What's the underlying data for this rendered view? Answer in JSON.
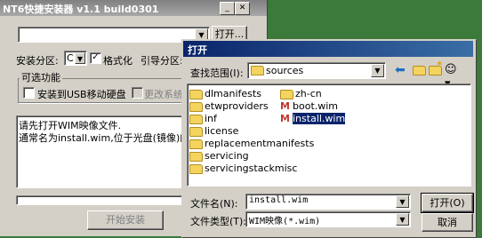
{
  "main_window": {
    "title": "NT6快捷安装器 v1.1 build0301",
    "open_button": "打开...",
    "install_partition_label": "安装分区:",
    "install_partition_value": "C",
    "format_label": "格式化",
    "boot_partition_label": "引导分区:",
    "options_group_label": "可选功能",
    "usb_install_label": "安装到USB移动硬盘",
    "change_system_label": "更改系统占",
    "log_lines": [
      "请先打开WIM映像文件.",
      "通常名为install.wim,位于光盘(镜像)的sources"
    ],
    "start_install_button": "开始安装"
  },
  "open_dialog": {
    "title": "打开",
    "look_in_label": "查找范围(I):",
    "look_in_value": "sources",
    "files_col1": [
      {
        "name": "dlmanifests",
        "type": "folder"
      },
      {
        "name": "etwproviders",
        "type": "folder"
      },
      {
        "name": "inf",
        "type": "folder"
      },
      {
        "name": "license",
        "type": "folder"
      },
      {
        "name": "replacementmanifests",
        "type": "folder"
      },
      {
        "name": "servicing",
        "type": "folder"
      },
      {
        "name": "servicingstackmisc",
        "type": "folder"
      }
    ],
    "files_col2": [
      {
        "name": "zh-cn",
        "type": "folder"
      },
      {
        "name": "boot.wim",
        "type": "wim"
      },
      {
        "name": "install.wim",
        "type": "wim",
        "selected": true
      }
    ],
    "filename_label": "文件名(N):",
    "filename_value": "install.wim",
    "filetype_label": "文件类型(T):",
    "filetype_value": "WIM映像(*.wim)",
    "open_button": "打开(O)",
    "cancel_button": "取消"
  },
  "colors": {
    "dialog_title_start": "#0a246a",
    "selection": "#0a246a",
    "window_face": "#d4d0c8"
  }
}
